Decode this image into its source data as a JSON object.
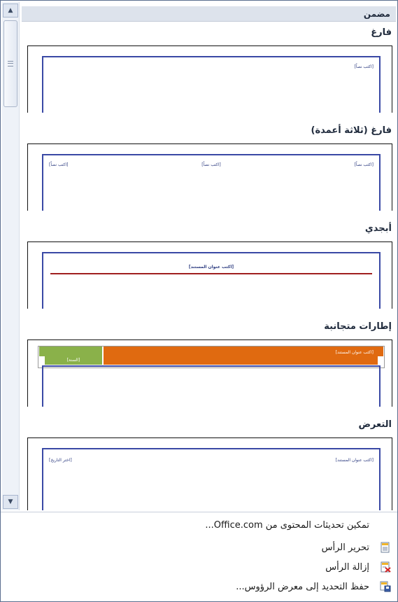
{
  "category": "مضمن",
  "scrollbar": {
    "up_glyph": "▲",
    "down_glyph": "▼"
  },
  "sections": [
    {
      "label": "فارغ",
      "placeholders": [
        "[اكتب نصاً]"
      ]
    },
    {
      "label": "فارغ (ثلاثة أعمدة)",
      "placeholders": [
        "[اكتب نصاً]",
        "[اكتب نصاً]",
        "[اكتب نصاً]"
      ]
    },
    {
      "label": "أبجدي",
      "placeholders": [
        "[اكتب عنوان المستند]"
      ]
    },
    {
      "label": "إطارات متجانبة",
      "placeholders": [
        "[اكتب عنوان المستند]",
        "[السنة]"
      ]
    },
    {
      "label": "التعرض",
      "placeholders": [
        "[اكتب عنوان المستند]",
        "[اختر التاريخ]"
      ]
    }
  ],
  "menu": [
    {
      "label": "تمكين تحديثات المحتوى من Office.com...",
      "icon": "none"
    },
    {
      "label": "تحرير الرأس",
      "icon": "edit-header-icon"
    },
    {
      "label": "إزالة الرأس",
      "icon": "remove-header-icon"
    },
    {
      "label": "حفظ التحديد إلى معرض الرؤوس...",
      "icon": "save-to-gallery-icon"
    }
  ],
  "colors": {
    "accent_blue": "#3a49a5",
    "rule_red": "#a01f1f",
    "tile_orange": "#e06a10",
    "tile_green": "#8ab14a"
  }
}
